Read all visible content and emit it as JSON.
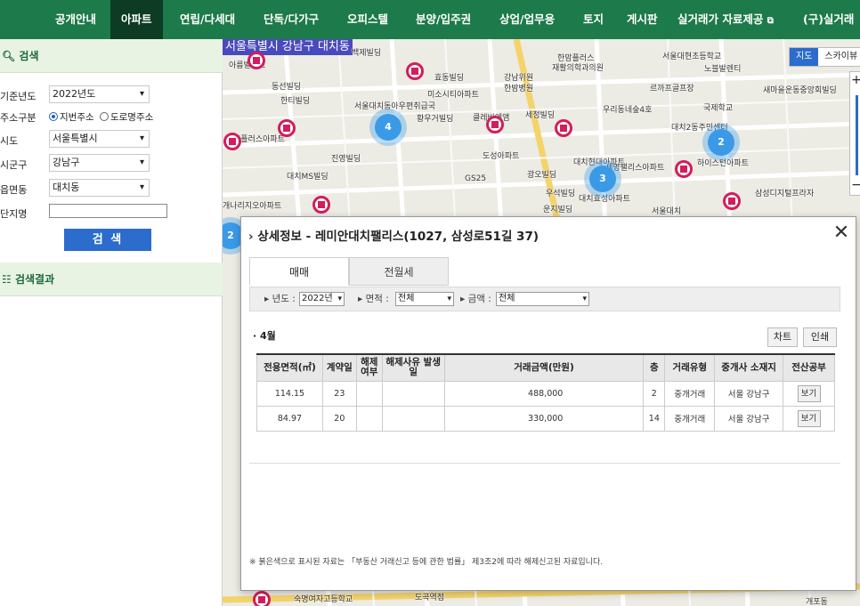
{
  "nav": {
    "items": [
      "공개안내",
      "아파트",
      "연립/다세대",
      "단독/다가구",
      "오피스텔",
      "분양/입주권",
      "상업/업무용",
      "토지",
      "게시판",
      "실거래가 자료제공",
      "(구)실거래"
    ],
    "active_index": 1
  },
  "search": {
    "title": "검색",
    "year_label": "기준년도",
    "year_value": "2022년도",
    "addr_type_label": "주소구분",
    "addr_option_jibun": "지번주소",
    "addr_option_road": "도로명주소",
    "addr_selected": "지번주소",
    "sido_label": "시도",
    "sido_value": "서울특별시",
    "sigungu_label": "시군구",
    "sigungu_value": "강남구",
    "dong_label": "읍면동",
    "dong_value": "대치동",
    "complex_label": "단지명",
    "complex_value": "",
    "search_button": "검 색"
  },
  "results": {
    "title": "검색결과"
  },
  "map": {
    "region_title": "서울특별시 강남구 대치동",
    "type_map": "지도",
    "type_sky": "스카이뷰",
    "zoom_in": "+",
    "zoom_out": "−",
    "clusters": [
      "4",
      "2",
      "3",
      "2"
    ],
    "labels": [
      "백제빌딩",
      "아름빌라트",
      "동선빌딩",
      "한티빌딩",
      "효동빌딩",
      "강남위원",
      "한밤병원",
      "한맘플러스",
      "재활의학과의원",
      "서울대현초등학교",
      "노블발렌티",
      "서울대치동아우편취급국",
      "미소시티아파트",
      "황우거빌딩",
      "클레비엔앰",
      "세정빌딩",
      "르까프골프장",
      "우리동네숲4호",
      "국제학교",
      "대치2동주민센터",
      "새마을운동중앙회빌딩",
      "휴플러스아파트",
      "진영빌딩",
      "대치MS빌딩",
      "도성아파트",
      "GS25",
      "광오빌딩",
      "대치현대아파트",
      "세영팰리스아파트",
      "하이스턴아파트",
      "삼성디지털프라자",
      "우석빌딩",
      "운지빌딩",
      "대치효성아파트",
      "서울대치",
      "개나리지오아파트",
      "도곡역점",
      "숙명여자고등학교",
      "개포동"
    ]
  },
  "dialog": {
    "title": "상세정보 - 레미안대치팰리스(1027, 삼성로51길 37)",
    "close": "✕",
    "tabs": [
      "매매",
      "전월세"
    ],
    "filters": {
      "year_label": "년도 :",
      "year_value": "2022년",
      "area_label": "면적 :",
      "area_value": "전체",
      "amount_label": "금액 :",
      "amount_value": "전체"
    },
    "month": "4월",
    "chart_button": "차트",
    "print_button": "인쇄",
    "table": {
      "headers": [
        "전용면적(㎡)",
        "계약일",
        "해제 여부",
        "해제사유 발생일",
        "거래금액(만원)",
        "층",
        "거래유형",
        "중개사 소재지",
        "전산공부"
      ],
      "rows": [
        [
          "114.15",
          "23",
          "",
          "",
          "488,000",
          "2",
          "중개거래",
          "서울 강남구",
          "보기"
        ],
        [
          "84.97",
          "20",
          "",
          "",
          "330,000",
          "14",
          "중개거래",
          "서울 강남구",
          "보기"
        ]
      ]
    },
    "footnote": "※ 붉은색으로 표시된 자료는 「부동산 거래신고 등에 관한 법률」 제3조2에 따라 해제신고된 자료입니다."
  },
  "colors": {
    "nav_bg": "#1d7a4a",
    "nav_active": "#0d3b24",
    "button_blue": "#2b6ccd",
    "pin": "#d21e5b",
    "cluster": "#3a9ae8"
  }
}
